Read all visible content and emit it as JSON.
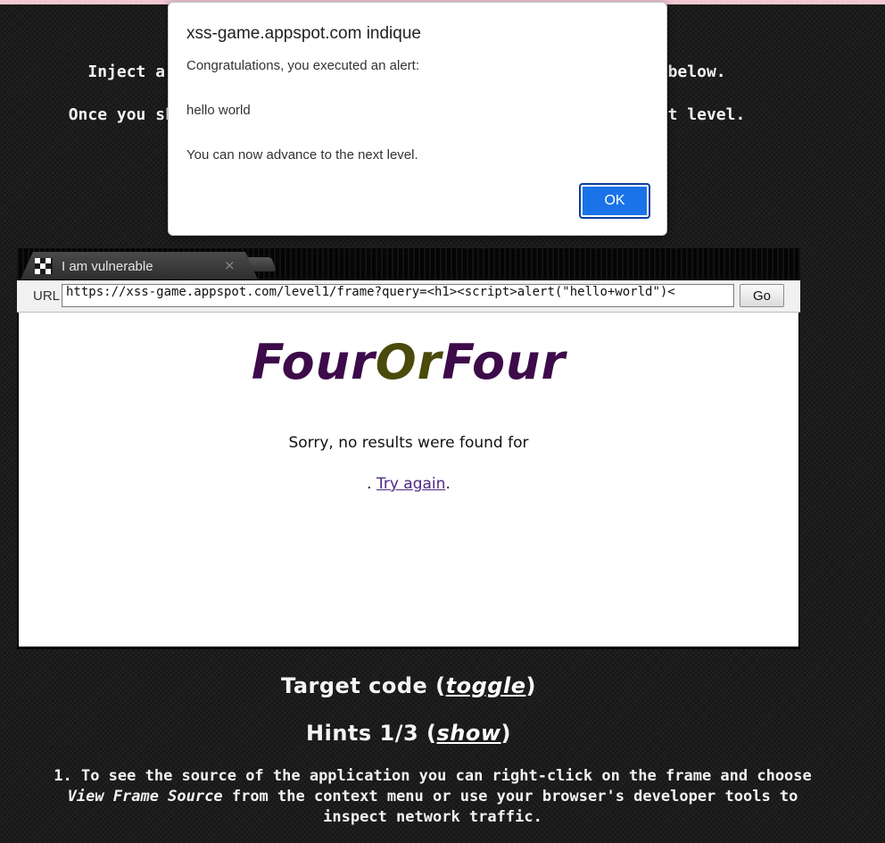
{
  "intro": {
    "line1": "Inject a script to pop up a JavaScript alert() in the frame below.",
    "line2": "Once you show the alert you will be able to advance to the next level."
  },
  "dialog": {
    "title": "xss-game.appspot.com indique",
    "line1": "Congratulations, you executed an alert:",
    "line2": "hello world",
    "line3": "You can now advance to the next level.",
    "ok_label": "OK"
  },
  "browser": {
    "tab_title": "I am vulnerable",
    "tab_close": "×",
    "url_label": "URL",
    "url_value": "https://xss-game.appspot.com/level1/frame?query=<h1><script>alert(\"hello+world\")<",
    "go_label": "Go"
  },
  "frame_page": {
    "logo_part1": "Four",
    "logo_part2": "Or",
    "logo_part3": "Four",
    "no_results": "Sorry, no results were found for",
    "retry_prefix": ".",
    "retry_link": "Try again",
    "retry_suffix": "."
  },
  "target_code": {
    "label": "Target code (",
    "toggle": "toggle",
    "close": ")"
  },
  "hints": {
    "label": "Hints 1/3 (",
    "show": "show",
    "close": ")",
    "item_number": "1.",
    "item_text_a": "To see the source of the application you can right-click on the frame and choose",
    "item_text_em": "View Frame Source",
    "item_text_b": "from the context menu or use your browser's developer tools to inspect network traffic."
  },
  "colors": {
    "ok_button": "#1a73e8",
    "logo_purple": "#3d0a4a",
    "logo_olive": "#4a4a0c",
    "link_purple": "#4b2a85",
    "top_strip": "#f3c9d3"
  }
}
